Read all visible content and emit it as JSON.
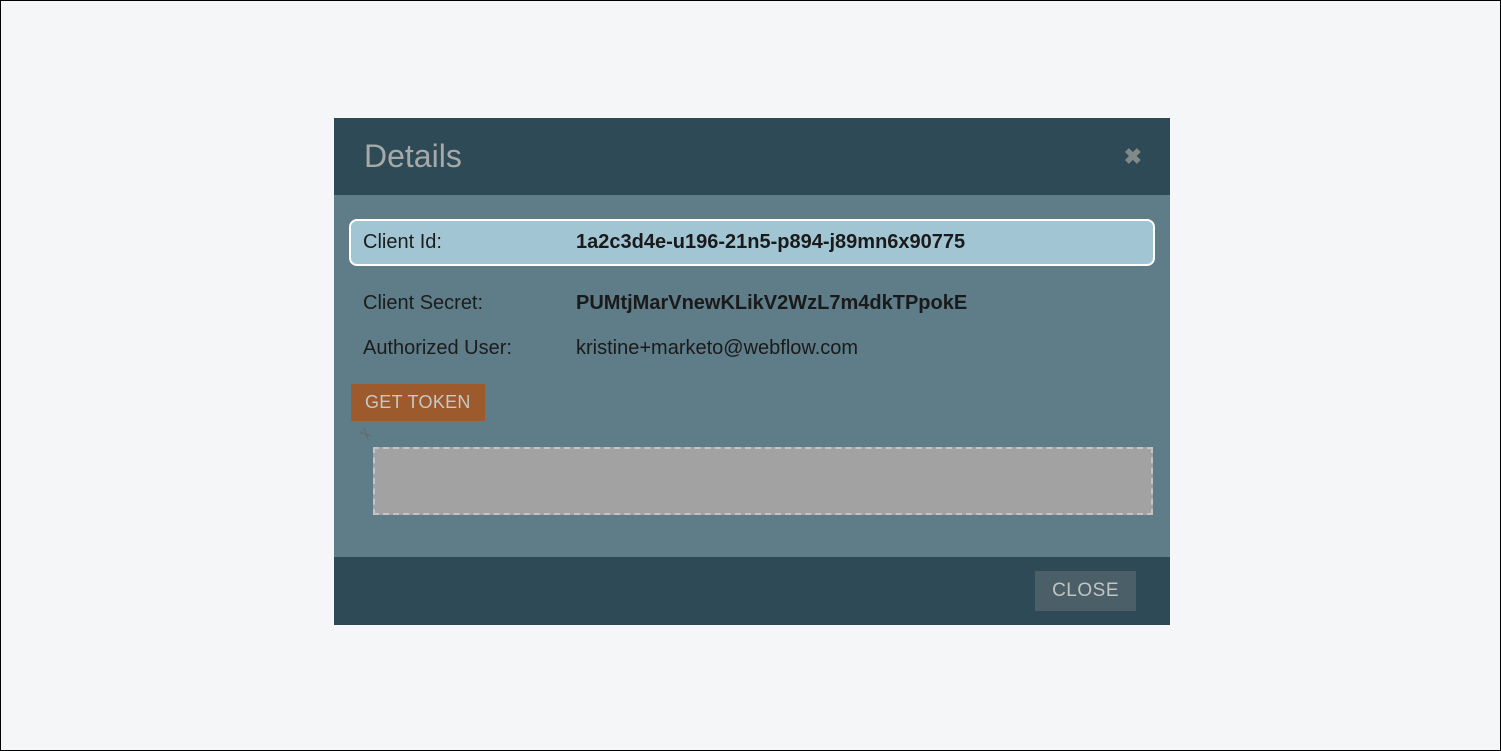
{
  "dialog": {
    "title": "Details",
    "closeIcon": "✖",
    "fields": {
      "clientId": {
        "label": "Client Id:",
        "value": "1a2c3d4e-u196-21n5-p894-j89mn6x90775"
      },
      "clientSecret": {
        "label": "Client Secret:",
        "value": "PUMtjMarVnewKLikV2WzL7m4dkTPpokE"
      },
      "authorizedUser": {
        "label": "Authorized User:",
        "value": "kristine+marketo@webflow.com"
      }
    },
    "getTokenLabel": "GET TOKEN",
    "scissorsIcon": "✂",
    "closeButtonLabel": "CLOSE"
  }
}
